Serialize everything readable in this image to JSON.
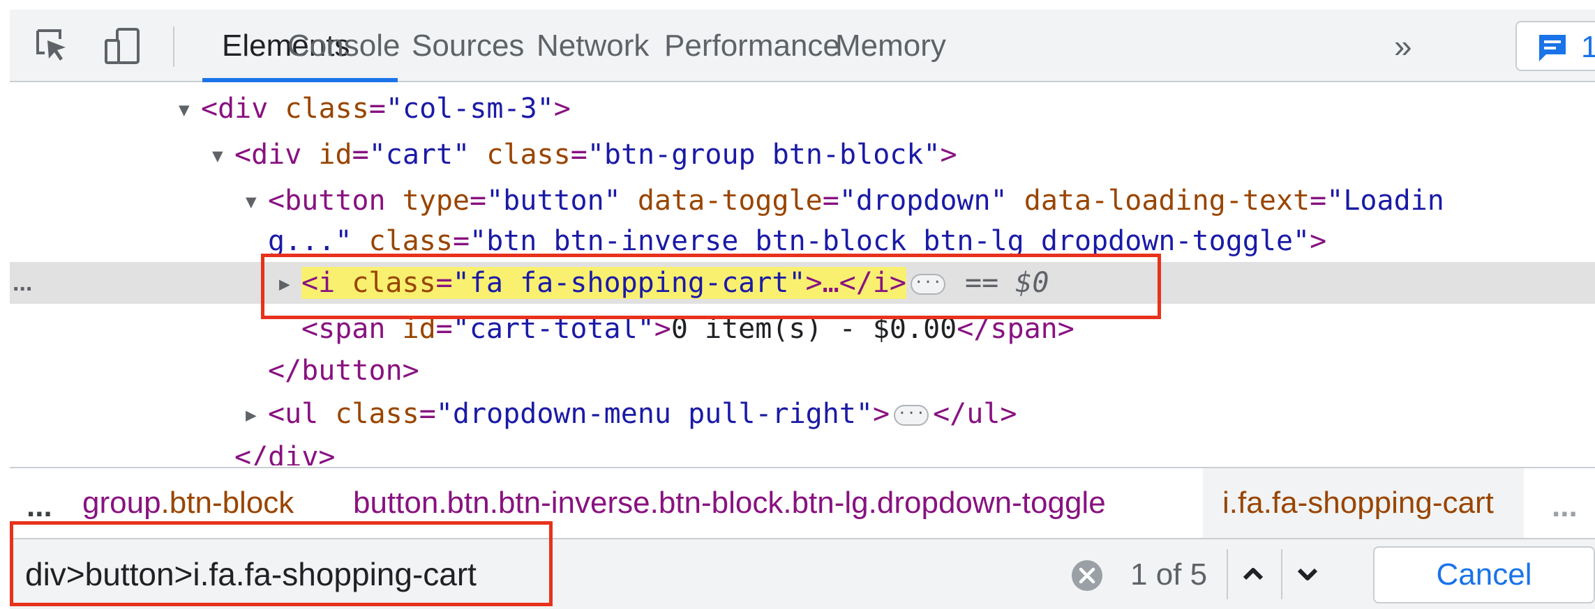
{
  "toolbar": {
    "tabs": [
      "Elements",
      "Console",
      "Sources",
      "Network",
      "Performance",
      "Memory"
    ],
    "active_tab": "Elements",
    "more_tabs_icon": "double-chevron-right",
    "more_tabs_glyph": "»",
    "issues_count": "1",
    "accent_color": "#1a73e8"
  },
  "tree": {
    "l1": {
      "tag_open": "<div ",
      "a1": "class",
      "eq": "=",
      "v1": "\"col-sm-3\"",
      "close": ">"
    },
    "l2": {
      "tag_open": "<div ",
      "a1": "id",
      "v1": "\"cart\"",
      "a2": "class",
      "v2": "\"btn-group btn-block\"",
      "close": ">"
    },
    "l3": {
      "tag_open": "<button ",
      "a1": "type",
      "v1": "\"button\"",
      "a2": "data-toggle",
      "v2": "\"dropdown\"",
      "a3": "data-loading-text",
      "v3": "\"Loadin"
    },
    "l4": {
      "v3_cont": "g...\"",
      "a4": "class",
      "v4": "\"btn btn-inverse btn-block btn-lg dropdown-toggle\"",
      "close": ">"
    },
    "l5": {
      "tag_open": "<i ",
      "a1": "class",
      "v1": "\"fa fa-shopping-cart\"",
      "mid": ">…</i>",
      "marker": "== $0",
      "gutter": "..."
    },
    "l6": {
      "tag_open": "<span ",
      "a1": "id",
      "v1": "\"cart-total\"",
      "gt": ">",
      "text": "0 item(s) - $0.00",
      "tag_close": "</span>"
    },
    "l7": {
      "tag_close": "</button>"
    },
    "l8": {
      "tag_open": "<ul ",
      "a1": "class",
      "v1": "\"dropdown-menu pull-right\"",
      "gt": ">",
      "tag_close": "</ul>"
    },
    "l9": {
      "tag_close": "</div>"
    },
    "ellipsis_pill": "···"
  },
  "breadcrumbs": {
    "overflow_left": "...",
    "c1_tag": "group",
    "c1_rest": ".btn-block",
    "c2": "button.btn.btn-inverse.btn-block.btn-lg.dropdown-toggle",
    "c3": "i.fa.fa-shopping-cart",
    "overflow_right": "..."
  },
  "search": {
    "value": "div>button>i.fa.fa-shopping-cart",
    "match_count": "1 of 5",
    "cancel_label": "Cancel"
  },
  "annotations": {
    "color": "#e8321c"
  }
}
